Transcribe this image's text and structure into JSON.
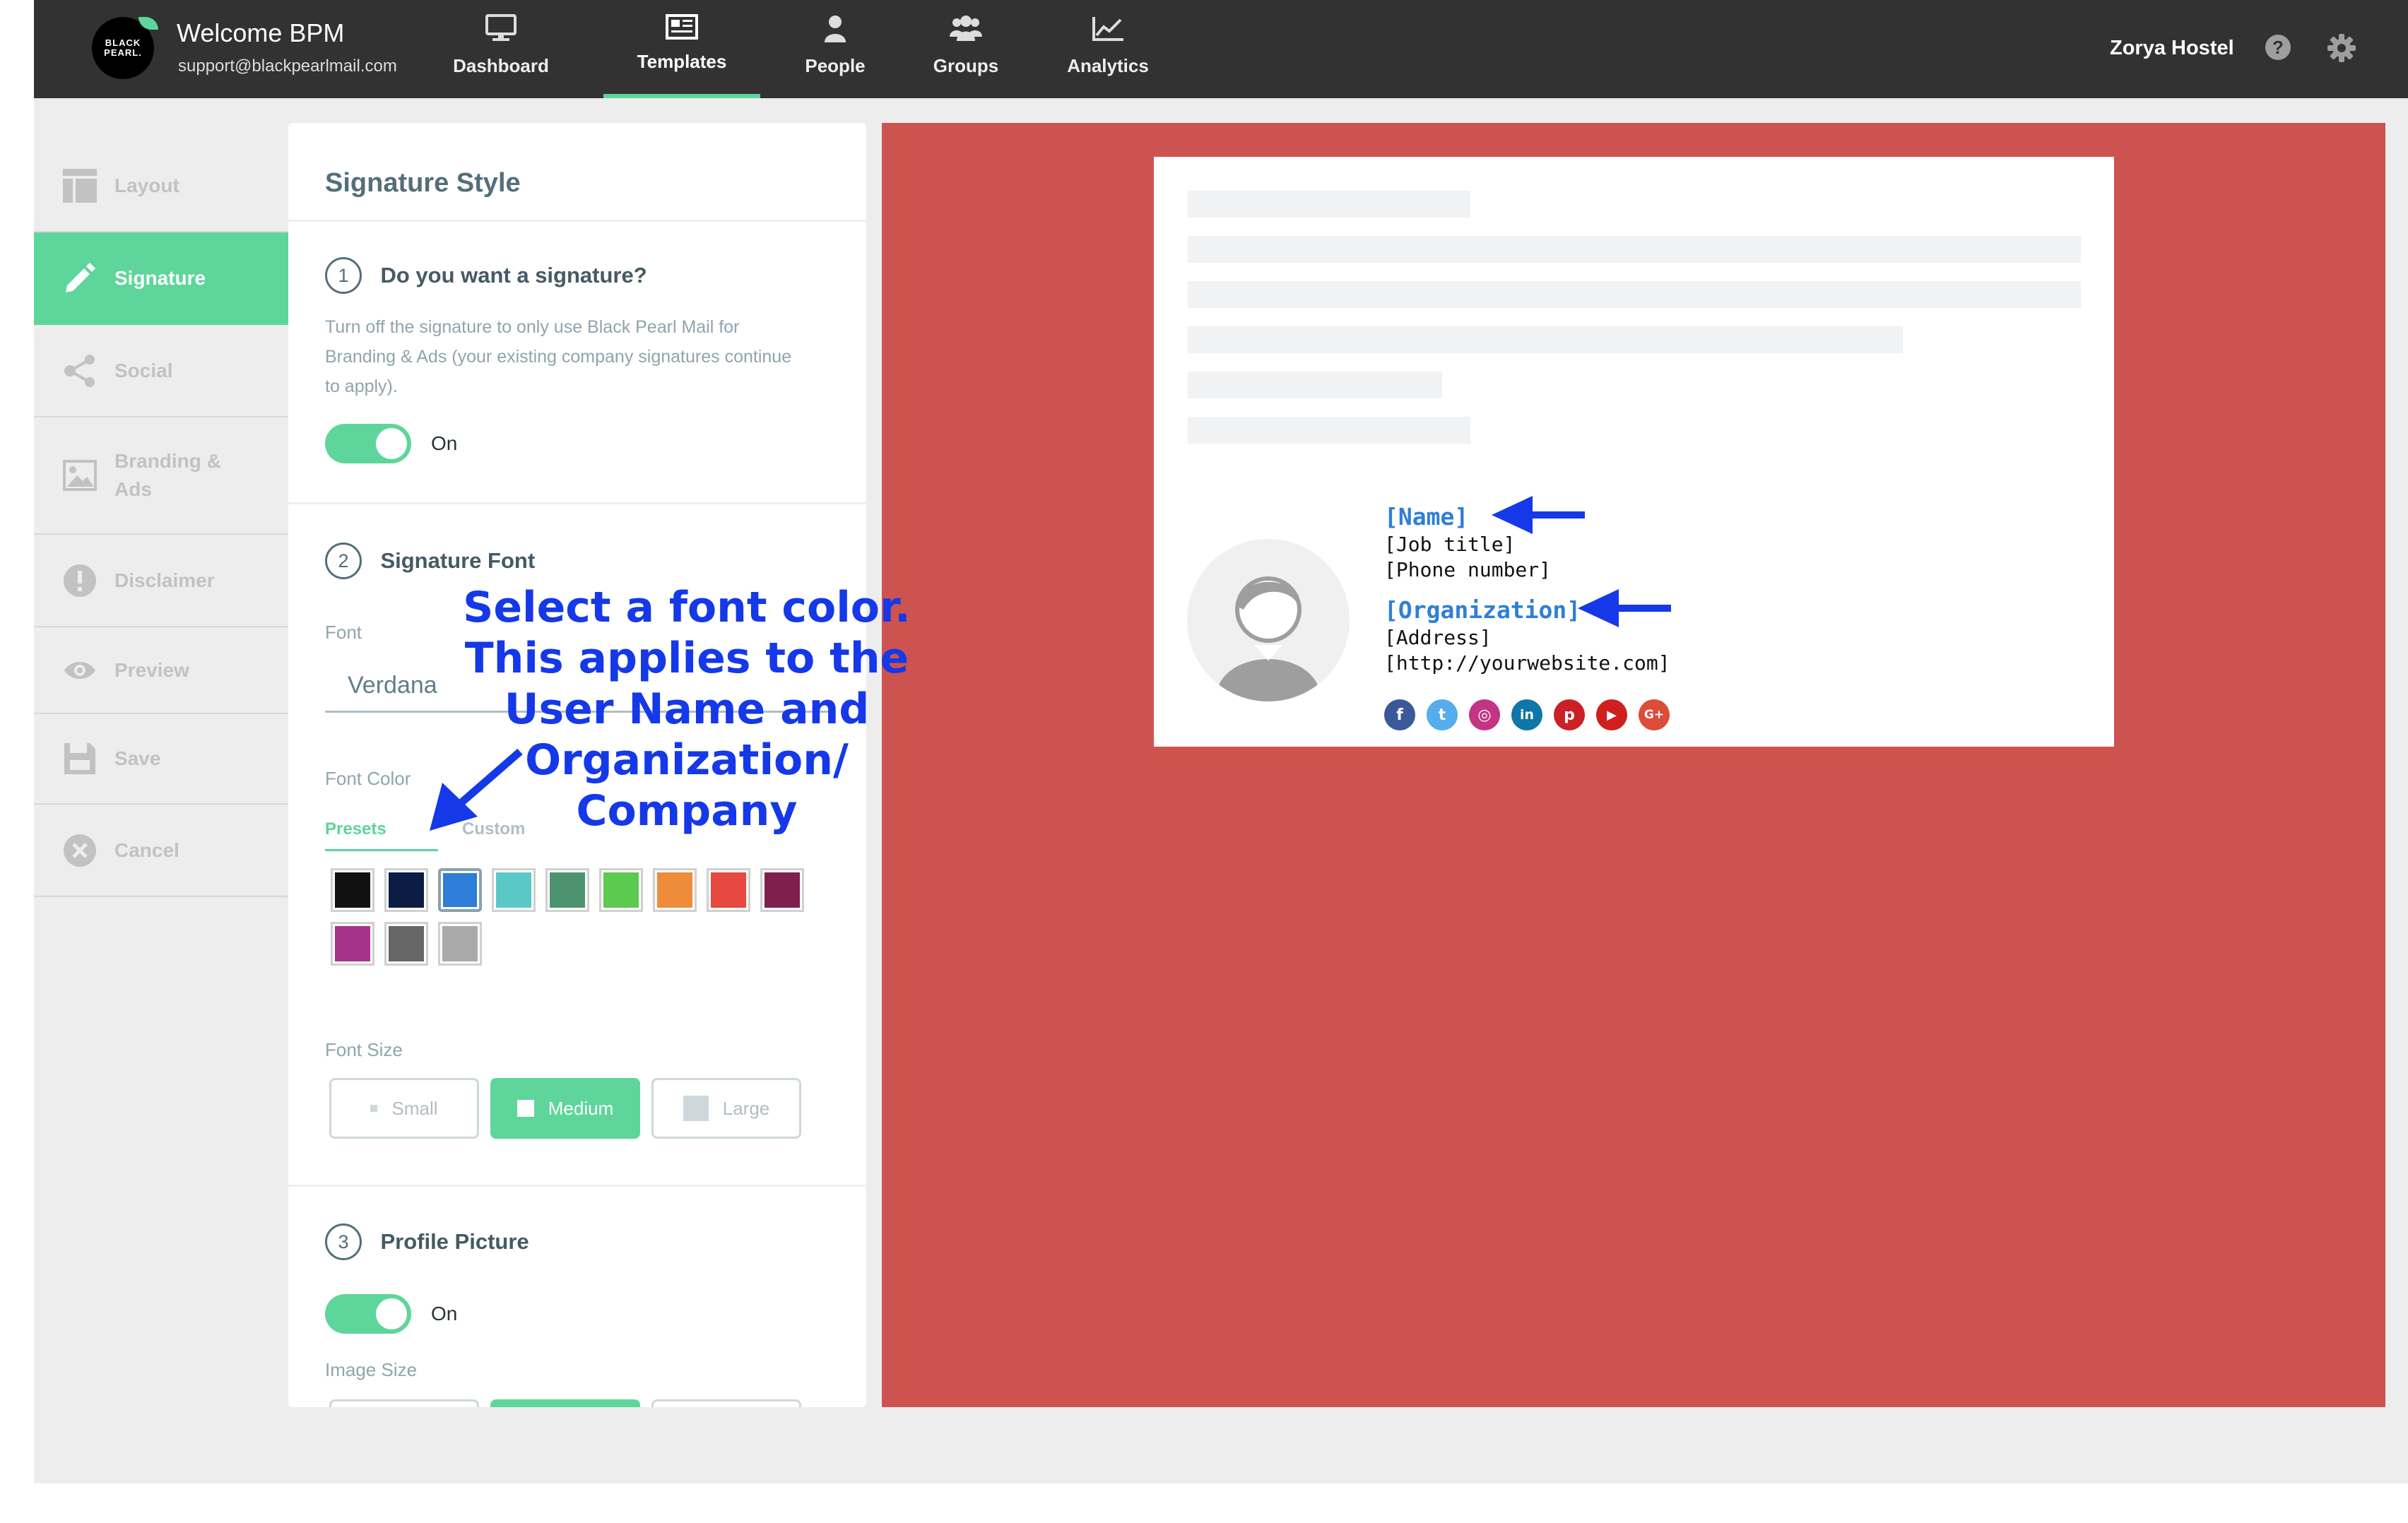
{
  "header": {
    "brand_logo_text": "BLACK PEARL.",
    "title": "Welcome BPM",
    "email": "support@blackpearlmail.com",
    "nav": [
      {
        "label": "Dashboard",
        "icon": "monitor-icon"
      },
      {
        "label": "Templates",
        "icon": "newspaper-icon",
        "active": true
      },
      {
        "label": "People",
        "icon": "person-icon"
      },
      {
        "label": "Groups",
        "icon": "group-icon"
      },
      {
        "label": "Analytics",
        "icon": "chart-icon"
      }
    ],
    "organization": "Zorya Hostel"
  },
  "sidebar": {
    "items": [
      {
        "label": "Layout",
        "icon": "layout-icon"
      },
      {
        "label": "Signature",
        "icon": "pencil-icon",
        "active": true
      },
      {
        "label": "Social",
        "icon": "share-icon"
      },
      {
        "label": "Branding & Ads",
        "icon": "image-icon"
      },
      {
        "label": "Disclaimer",
        "icon": "exclamation-icon"
      },
      {
        "label": "Preview",
        "icon": "eye-icon"
      },
      {
        "label": "Save",
        "icon": "floppy-icon"
      },
      {
        "label": "Cancel",
        "icon": "cancel-icon"
      }
    ]
  },
  "panel": {
    "title": "Signature Style",
    "step1": {
      "number": "1",
      "title": "Do you want a signature?",
      "description": "Turn off the signature to only use Black Pearl Mail for Branding & Ads (your existing company signatures continue to apply).",
      "toggle_label": "On"
    },
    "step2": {
      "number": "2",
      "title": "Signature Font",
      "font_label": "Font",
      "font_value": "Verdana",
      "color_label": "Font Color",
      "tabs": [
        "Presets",
        "Custom"
      ],
      "swatches": [
        "#111111",
        "#0b1d45",
        "#2f7ed8",
        "#5bc8c8",
        "#4c9470",
        "#5cc94f",
        "#ef8c3a",
        "#e5493f",
        "#7e1f4c",
        "#a6338a",
        "#666666",
        "#aaaaaa"
      ],
      "selected_swatch": "#2f7ed8",
      "size_label": "Font Size",
      "sizes": [
        "Small",
        "Medium",
        "Large"
      ],
      "selected_size": "Medium"
    },
    "step3": {
      "number": "3",
      "title": "Profile Picture",
      "toggle_label": "On",
      "image_size_label": "Image Size"
    }
  },
  "preview": {
    "signature": {
      "name": "[Name]",
      "job_title": "[Job title]",
      "phone": "[Phone number]",
      "organization": "[Organization]",
      "address": "[Address]",
      "website": "[http://yourwebsite.com]"
    },
    "socials": [
      {
        "icon": "facebook-icon",
        "glyph": "f",
        "color": "#3b5998"
      },
      {
        "icon": "twitter-icon",
        "glyph": "t",
        "color": "#55acee"
      },
      {
        "icon": "instagram-icon",
        "glyph": "◎",
        "color": "#c13584"
      },
      {
        "icon": "linkedin-icon",
        "glyph": "in",
        "color": "#0e76a8"
      },
      {
        "icon": "pinterest-icon",
        "glyph": "p",
        "color": "#cb2027"
      },
      {
        "icon": "youtube-icon",
        "glyph": "▶",
        "color": "#cd201f"
      },
      {
        "icon": "googleplus-icon",
        "glyph": "G+",
        "color": "#dd4b39"
      }
    ]
  },
  "annotation": {
    "text": "Select a font color. This applies to the User Name and Organization/ Company",
    "arrow_color": "#1538e8"
  },
  "colors": {
    "accent": "#5ed59b",
    "topbar": "#323232",
    "preview_bg": "#cd5350"
  }
}
